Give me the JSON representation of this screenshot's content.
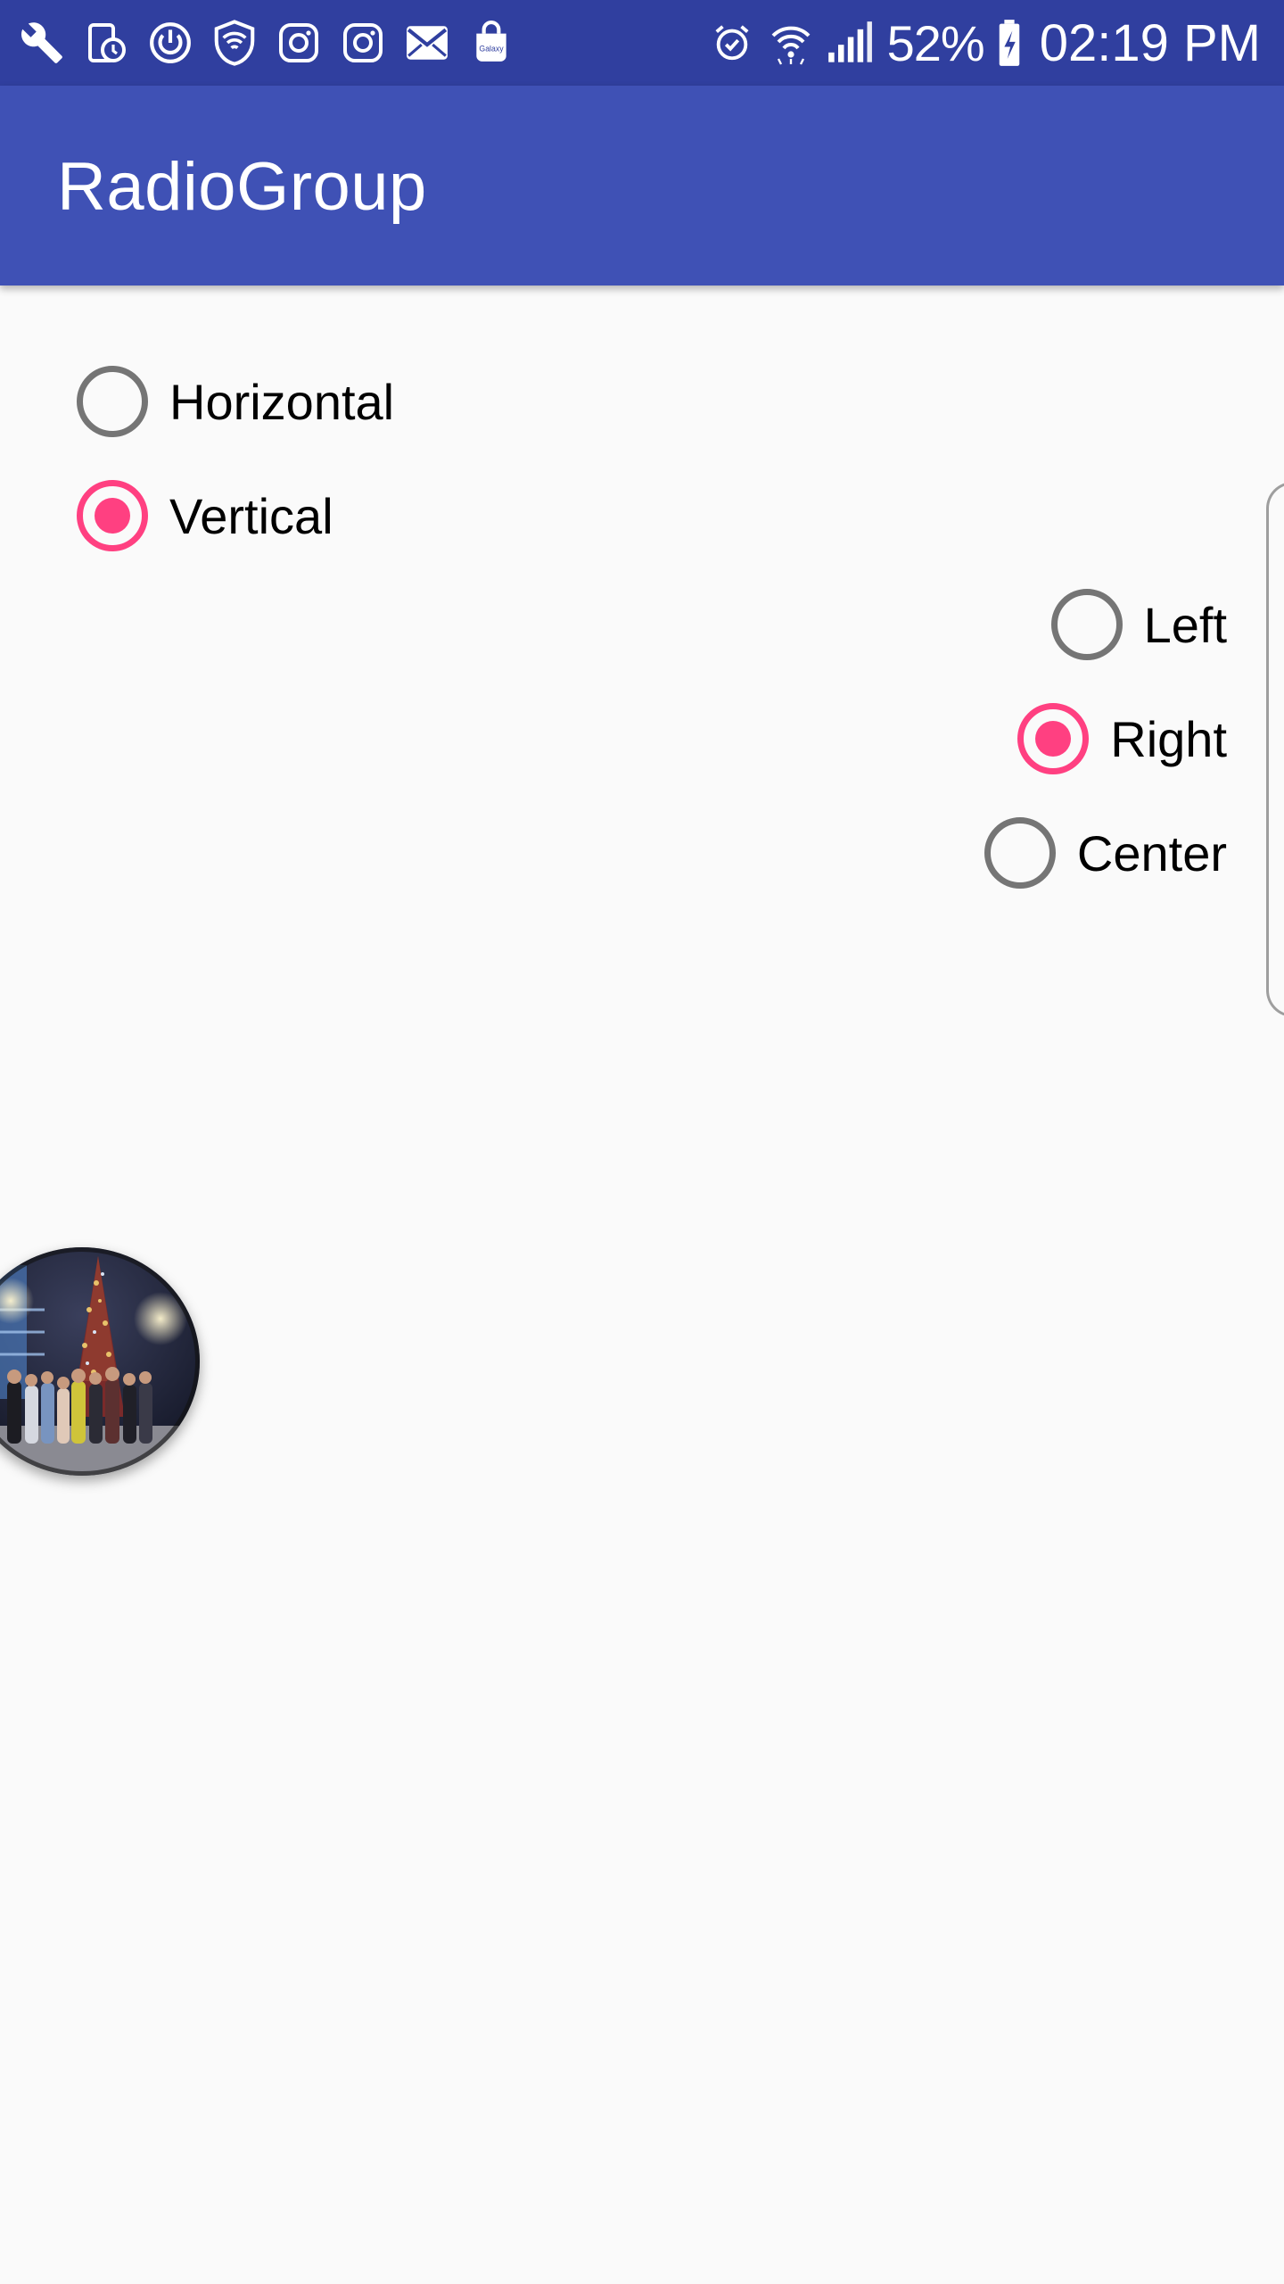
{
  "status_bar": {
    "left_icons": [
      "wrench-icon",
      "phone-schedule-icon",
      "power-timer-icon",
      "shield-wifi-icon",
      "instagram-icon",
      "instagram-icon",
      "mail-icon",
      "galaxy-store-icon"
    ],
    "galaxy_label": "Galaxy",
    "right_icons": [
      "alarm-icon",
      "wifi-icon",
      "cellular-signal-icon",
      "battery-charging-icon"
    ],
    "battery_percent": "52%",
    "time": "02:19 PM",
    "background": "#303f9f"
  },
  "app_bar": {
    "title": "RadioGroup",
    "background": "#3f51b5"
  },
  "orientation_group": {
    "options": [
      {
        "label": "Horizontal",
        "checked": false
      },
      {
        "label": "Vertical",
        "checked": true
      }
    ]
  },
  "gravity_group": {
    "options": [
      {
        "label": "Left",
        "checked": false
      },
      {
        "label": "Right",
        "checked": true
      },
      {
        "label": "Center",
        "checked": false
      }
    ]
  },
  "colors": {
    "accent": "#ff4081",
    "radio_unchecked": "#757575",
    "background": "#fafafa"
  },
  "photo": {
    "description_icon": "group-photo"
  }
}
